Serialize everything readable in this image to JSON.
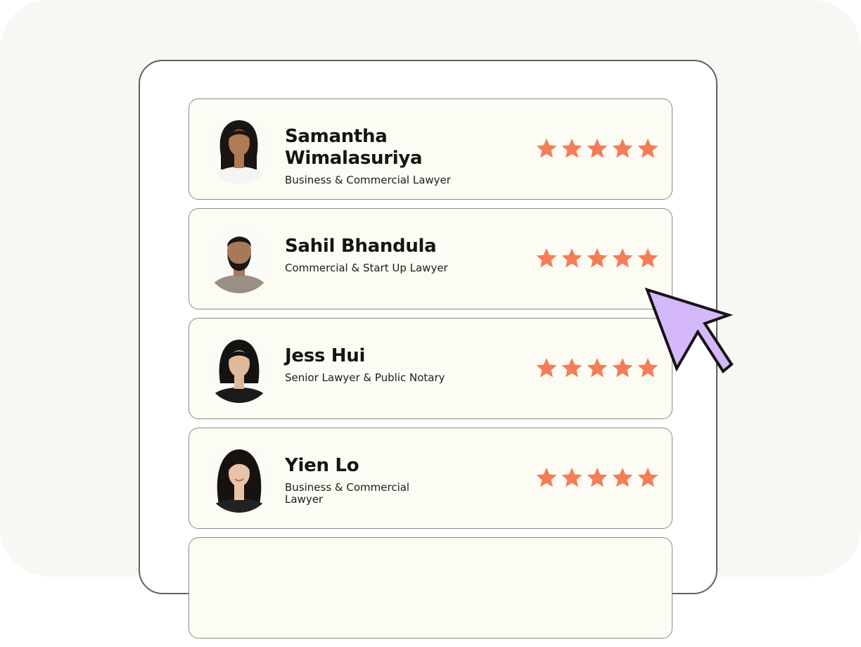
{
  "lawyers": [
    {
      "name": "Samantha Wimalasuriya",
      "role": "Business & Commercial Lawyer",
      "rating": 5,
      "skin": "#b07a55",
      "hair": "#1a1412",
      "shirt": "#f4f4f2"
    },
    {
      "name": "Sahil Bhandula",
      "role": "Commercial & Start Up Lawyer",
      "rating": 5,
      "skin": "#a8785a",
      "hair": "#1b1715",
      "shirt": "#9a8f84"
    },
    {
      "name": "Jess Hui",
      "role": "Senior Lawyer & Public Notary",
      "rating": 5,
      "skin": "#e0b89a",
      "hair": "#151212",
      "shirt": "#1a1a1a"
    },
    {
      "name": "Yien Lo",
      "role": "Business & Commercial Lawyer",
      "rating": 5,
      "skin": "#e8c3a8",
      "hair": "#17120f",
      "shirt": "#222222"
    }
  ],
  "icons": {
    "star": "star-icon",
    "cursor": "cursor-arrow-icon"
  },
  "colors": {
    "star": "#f47d57",
    "cursor_fill": "#d4b8fa",
    "card_bg": "#fcfcf4",
    "backdrop": "#f7f7f3"
  }
}
